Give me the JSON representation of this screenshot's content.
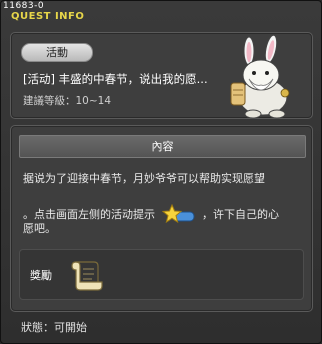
{
  "quest_id": "11683-0",
  "window_title": "QUEST INFO",
  "quest": {
    "category": "活動",
    "name": "[活动] 丰盛的中春节，说出我的愿...",
    "level_requirement": "建議等級：10~14"
  },
  "details": {
    "header": "內容",
    "line1": "据说为了迎接中春节，月妙爷爷可以帮助实现愿望",
    "line2_pre": "。点击画面左侧的活动提示",
    "line2_post": "，许下自己的心",
    "line3": "愿吧。",
    "hint_icon": "star-notification-icon"
  },
  "reward": {
    "label": "獎勵",
    "icon": "scroll-icon"
  },
  "status": "狀態：可開始"
}
